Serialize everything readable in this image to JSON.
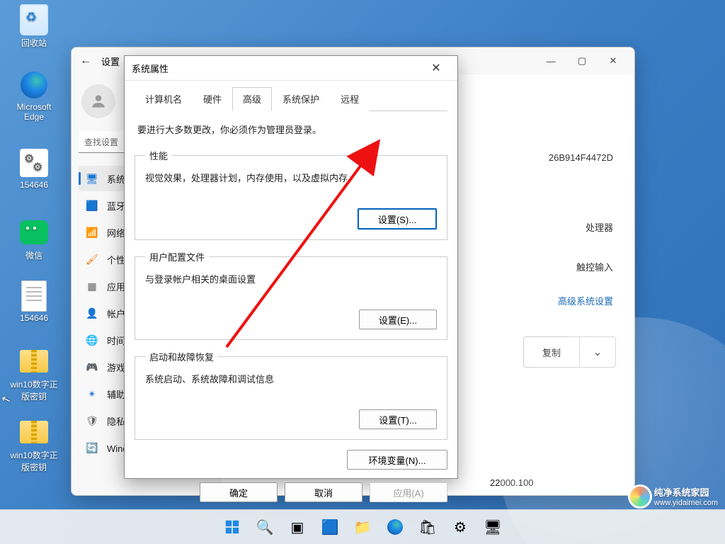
{
  "desktop": {
    "recycle": "回收站",
    "edge": "Microsoft Edge",
    "gear": "154646",
    "wechat": "微信",
    "txt": "154646",
    "zip1": "win10数字正版密钥",
    "zip2": "win10数字正版密钥"
  },
  "settings": {
    "title": "设置",
    "search_placeholder": "查找设置",
    "nav": {
      "system": "系统",
      "bluetooth": "蓝牙",
      "network": "网络",
      "personal": "个性",
      "apps": "应用",
      "accounts": "帐户",
      "time": "时间",
      "gaming": "游戏",
      "accessibility": "辅助",
      "privacy": "隐私",
      "update": "Windows 更新"
    },
    "content": {
      "id_fragment": "26B914F4472D",
      "processor": "处理器",
      "touch": "触控输入",
      "advanced_link": "高级系统设置",
      "copy": "复制",
      "build": "22000.100"
    }
  },
  "sysprop": {
    "title": "系统属性",
    "tabs": {
      "computer": "计算机名",
      "hardware": "硬件",
      "advanced": "高级",
      "protect": "系统保护",
      "remote": "远程"
    },
    "admin_note": "要进行大多数更改，你必须作为管理员登录。",
    "perf": {
      "legend": "性能",
      "desc": "视觉效果，处理器计划，内存使用，以及虚拟内存",
      "btn": "设置(S)..."
    },
    "profile": {
      "legend": "用户配置文件",
      "desc": "与登录帐户相关的桌面设置",
      "btn": "设置(E)..."
    },
    "startup": {
      "legend": "启动和故障恢复",
      "desc": "系统启动、系统故障和调试信息",
      "btn": "设置(T)..."
    },
    "env_btn": "环境变量(N)...",
    "ok": "确定",
    "cancel": "取消",
    "apply": "应用(A)"
  },
  "watermark": {
    "line1": "纯净系统家园",
    "line2": "www.yidaimei.com"
  },
  "colors": {
    "accent": "#0a66c2",
    "link": "#1e6bb8"
  }
}
